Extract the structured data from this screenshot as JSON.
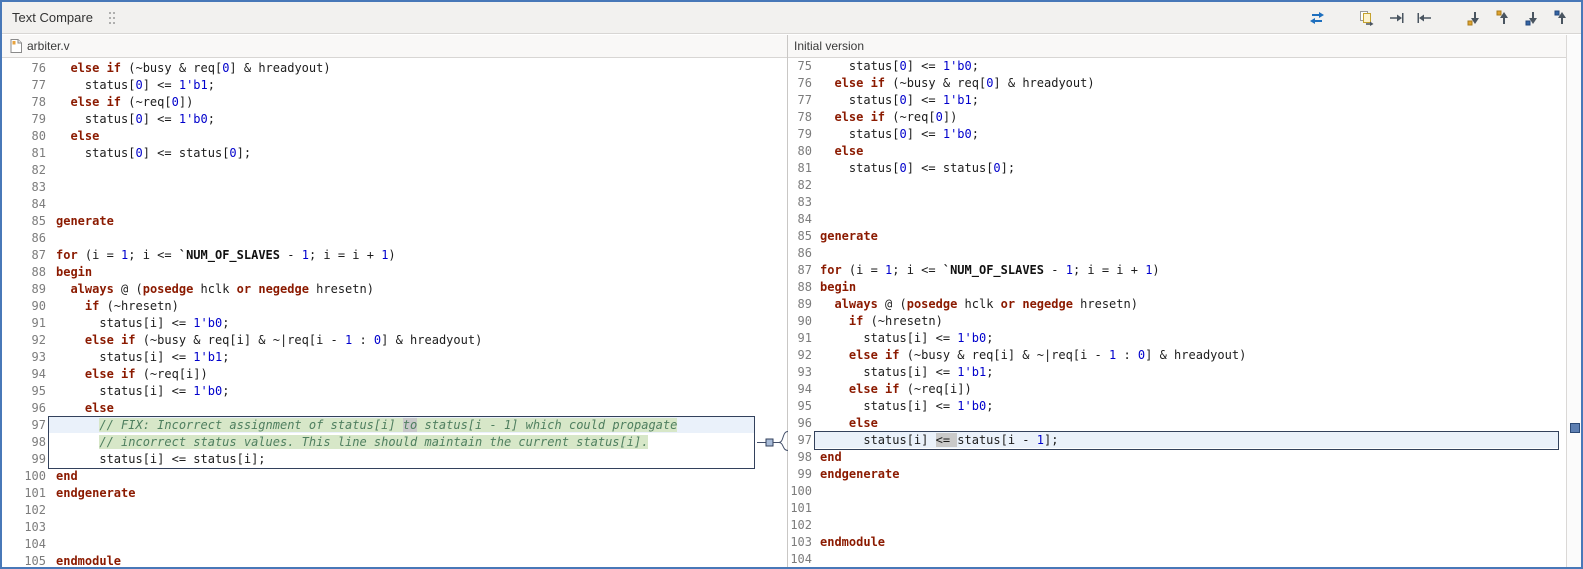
{
  "toolbar": {
    "title": "Text Compare",
    "icons": [
      "swap-left-right",
      "copy-all-left-to-right",
      "copy-current-left-to-right",
      "copy-current-right-to-left",
      "next-difference",
      "previous-difference",
      "next-change",
      "previous-change"
    ]
  },
  "colors": {
    "frame_border": "#4878b8",
    "keyword": "#8b1a00",
    "number": "#0000cc",
    "comment": "#4f7f5f",
    "macro": "#111111",
    "line_number": "#7c7c7c",
    "added_token_bg": "#d7e7c8",
    "changed_token_bg": "#c9c9c9",
    "diff_box_border": "#33415c"
  },
  "diff": {
    "left_from": 97,
    "left_to": 99,
    "right_from": 97,
    "right_to": 97
  },
  "left_pane": {
    "header": "arbiter.v",
    "lines": [
      {
        "n": 76,
        "s": [
          [
            "p",
            "  "
          ],
          [
            "k",
            "else if"
          ],
          [
            "p",
            " (~busy & req["
          ],
          [
            "n",
            "0"
          ],
          [
            "p",
            "] & hreadyout)"
          ]
        ]
      },
      {
        "n": 77,
        "s": [
          [
            "p",
            "    status["
          ],
          [
            "n",
            "0"
          ],
          [
            "p",
            "] <= "
          ],
          [
            "n",
            "1'b1"
          ],
          [
            "p",
            ";"
          ]
        ]
      },
      {
        "n": 78,
        "s": [
          [
            "p",
            "  "
          ],
          [
            "k",
            "else if"
          ],
          [
            "p",
            " (~req["
          ],
          [
            "n",
            "0"
          ],
          [
            "p",
            "])"
          ]
        ]
      },
      {
        "n": 79,
        "s": [
          [
            "p",
            "    status["
          ],
          [
            "n",
            "0"
          ],
          [
            "p",
            "] <= "
          ],
          [
            "n",
            "1'b0"
          ],
          [
            "p",
            ";"
          ]
        ]
      },
      {
        "n": 80,
        "s": [
          [
            "p",
            "  "
          ],
          [
            "k",
            "else"
          ]
        ]
      },
      {
        "n": 81,
        "s": [
          [
            "p",
            "    status["
          ],
          [
            "n",
            "0"
          ],
          [
            "p",
            "] <= status["
          ],
          [
            "n",
            "0"
          ],
          [
            "p",
            "];"
          ]
        ]
      },
      {
        "n": 82,
        "s": []
      },
      {
        "n": 83,
        "s": []
      },
      {
        "n": 84,
        "s": []
      },
      {
        "n": 85,
        "s": [
          [
            "k",
            "generate"
          ]
        ]
      },
      {
        "n": 86,
        "s": []
      },
      {
        "n": 87,
        "s": [
          [
            "k",
            "for"
          ],
          [
            "p",
            " (i = "
          ],
          [
            "n",
            "1"
          ],
          [
            "p",
            "; i <= "
          ],
          [
            "m",
            "`NUM_OF_SLAVES"
          ],
          [
            "p",
            " - "
          ],
          [
            "n",
            "1"
          ],
          [
            "p",
            "; i = i + "
          ],
          [
            "n",
            "1"
          ],
          [
            "p",
            ")"
          ]
        ]
      },
      {
        "n": 88,
        "s": [
          [
            "k",
            "begin"
          ]
        ]
      },
      {
        "n": 89,
        "s": [
          [
            "p",
            "  "
          ],
          [
            "k",
            "always"
          ],
          [
            "p",
            " @ ("
          ],
          [
            "k",
            "posedge"
          ],
          [
            "p",
            " hclk "
          ],
          [
            "k",
            "or"
          ],
          [
            "p",
            " "
          ],
          [
            "k",
            "negedge"
          ],
          [
            "p",
            " hresetn)"
          ]
        ]
      },
      {
        "n": 90,
        "s": [
          [
            "p",
            "    "
          ],
          [
            "k",
            "if"
          ],
          [
            "p",
            " (~hresetn)"
          ]
        ]
      },
      {
        "n": 91,
        "s": [
          [
            "p",
            "      status[i] <= "
          ],
          [
            "n",
            "1'b0"
          ],
          [
            "p",
            ";"
          ]
        ]
      },
      {
        "n": 92,
        "s": [
          [
            "p",
            "    "
          ],
          [
            "k",
            "else if"
          ],
          [
            "p",
            " (~busy & req[i] & ~|req[i - "
          ],
          [
            "n",
            "1"
          ],
          [
            "p",
            " : "
          ],
          [
            "n",
            "0"
          ],
          [
            "p",
            "] & hreadyout)"
          ]
        ]
      },
      {
        "n": 93,
        "s": [
          [
            "p",
            "      status[i] <= "
          ],
          [
            "n",
            "1'b1"
          ],
          [
            "p",
            ";"
          ]
        ]
      },
      {
        "n": 94,
        "s": [
          [
            "p",
            "    "
          ],
          [
            "k",
            "else if"
          ],
          [
            "p",
            " (~req[i])"
          ]
        ]
      },
      {
        "n": 95,
        "s": [
          [
            "p",
            "      status[i] <= "
          ],
          [
            "n",
            "1'b0"
          ],
          [
            "p",
            ";"
          ]
        ]
      },
      {
        "n": 96,
        "s": [
          [
            "p",
            "    "
          ],
          [
            "k",
            "else"
          ]
        ]
      },
      {
        "n": 97,
        "s": [
          [
            "p",
            "      "
          ],
          [
            "c",
            "// FIX: Incorrect assignment of status[i] ",
            "hg"
          ],
          [
            "c",
            "to",
            "hx"
          ],
          [
            "c",
            " status[i - 1] which could propagate",
            "hg"
          ]
        ]
      },
      {
        "n": 98,
        "s": [
          [
            "p",
            "      "
          ],
          [
            "c",
            "// incorrect status values. This line should maintain the current status[i].",
            "hg"
          ]
        ]
      },
      {
        "n": 99,
        "s": [
          [
            "p",
            "      status[i] <= status[i];"
          ]
        ]
      },
      {
        "n": 100,
        "s": [
          [
            "k",
            "end"
          ]
        ]
      },
      {
        "n": 101,
        "s": [
          [
            "k",
            "endgenerate"
          ]
        ]
      },
      {
        "n": 102,
        "s": []
      },
      {
        "n": 103,
        "s": []
      },
      {
        "n": 104,
        "s": []
      },
      {
        "n": 105,
        "s": [
          [
            "k",
            "endmodule"
          ]
        ]
      }
    ]
  },
  "right_pane": {
    "header": "Initial version",
    "lines": [
      {
        "n": 75,
        "s": [
          [
            "p",
            "    status["
          ],
          [
            "n",
            "0"
          ],
          [
            "p",
            "] <= "
          ],
          [
            "n",
            "1'b0"
          ],
          [
            "p",
            ";"
          ]
        ]
      },
      {
        "n": 76,
        "s": [
          [
            "p",
            "  "
          ],
          [
            "k",
            "else if"
          ],
          [
            "p",
            " (~busy & req["
          ],
          [
            "n",
            "0"
          ],
          [
            "p",
            "] & hreadyout)"
          ]
        ]
      },
      {
        "n": 77,
        "s": [
          [
            "p",
            "    status["
          ],
          [
            "n",
            "0"
          ],
          [
            "p",
            "] <= "
          ],
          [
            "n",
            "1'b1"
          ],
          [
            "p",
            ";"
          ]
        ]
      },
      {
        "n": 78,
        "s": [
          [
            "p",
            "  "
          ],
          [
            "k",
            "else if"
          ],
          [
            "p",
            " (~req["
          ],
          [
            "n",
            "0"
          ],
          [
            "p",
            "])"
          ]
        ]
      },
      {
        "n": 79,
        "s": [
          [
            "p",
            "    status["
          ],
          [
            "n",
            "0"
          ],
          [
            "p",
            "] <= "
          ],
          [
            "n",
            "1'b0"
          ],
          [
            "p",
            ";"
          ]
        ]
      },
      {
        "n": 80,
        "s": [
          [
            "p",
            "  "
          ],
          [
            "k",
            "else"
          ]
        ]
      },
      {
        "n": 81,
        "s": [
          [
            "p",
            "    status["
          ],
          [
            "n",
            "0"
          ],
          [
            "p",
            "] <= status["
          ],
          [
            "n",
            "0"
          ],
          [
            "p",
            "];"
          ]
        ]
      },
      {
        "n": 82,
        "s": []
      },
      {
        "n": 83,
        "s": []
      },
      {
        "n": 84,
        "s": []
      },
      {
        "n": 85,
        "s": [
          [
            "k",
            "generate"
          ]
        ]
      },
      {
        "n": 86,
        "s": []
      },
      {
        "n": 87,
        "s": [
          [
            "k",
            "for"
          ],
          [
            "p",
            " (i = "
          ],
          [
            "n",
            "1"
          ],
          [
            "p",
            "; i <= "
          ],
          [
            "m",
            "`NUM_OF_SLAVES"
          ],
          [
            "p",
            " - "
          ],
          [
            "n",
            "1"
          ],
          [
            "p",
            "; i = i + "
          ],
          [
            "n",
            "1"
          ],
          [
            "p",
            ")"
          ]
        ]
      },
      {
        "n": 88,
        "s": [
          [
            "k",
            "begin"
          ]
        ]
      },
      {
        "n": 89,
        "s": [
          [
            "p",
            "  "
          ],
          [
            "k",
            "always"
          ],
          [
            "p",
            " @ ("
          ],
          [
            "k",
            "posedge"
          ],
          [
            "p",
            " hclk "
          ],
          [
            "k",
            "or"
          ],
          [
            "p",
            " "
          ],
          [
            "k",
            "negedge"
          ],
          [
            "p",
            " hresetn)"
          ]
        ]
      },
      {
        "n": 90,
        "s": [
          [
            "p",
            "    "
          ],
          [
            "k",
            "if"
          ],
          [
            "p",
            " (~hresetn)"
          ]
        ]
      },
      {
        "n": 91,
        "s": [
          [
            "p",
            "      status[i] <= "
          ],
          [
            "n",
            "1'b0"
          ],
          [
            "p",
            ";"
          ]
        ]
      },
      {
        "n": 92,
        "s": [
          [
            "p",
            "    "
          ],
          [
            "k",
            "else if"
          ],
          [
            "p",
            " (~busy & req[i] & ~|req[i - "
          ],
          [
            "n",
            "1"
          ],
          [
            "p",
            " : "
          ],
          [
            "n",
            "0"
          ],
          [
            "p",
            "] & hreadyout)"
          ]
        ]
      },
      {
        "n": 93,
        "s": [
          [
            "p",
            "      status[i] <= "
          ],
          [
            "n",
            "1'b1"
          ],
          [
            "p",
            ";"
          ]
        ]
      },
      {
        "n": 94,
        "s": [
          [
            "p",
            "    "
          ],
          [
            "k",
            "else if"
          ],
          [
            "p",
            " (~req[i])"
          ]
        ]
      },
      {
        "n": 95,
        "s": [
          [
            "p",
            "      status[i] <= "
          ],
          [
            "n",
            "1'b0"
          ],
          [
            "p",
            ";"
          ]
        ]
      },
      {
        "n": 96,
        "s": [
          [
            "p",
            "    "
          ],
          [
            "k",
            "else"
          ]
        ]
      },
      {
        "n": 97,
        "s": [
          [
            "p",
            "      status[i] "
          ],
          [
            "p",
            "<= ",
            "hx"
          ],
          [
            "p",
            "status[i - "
          ],
          [
            "n",
            "1"
          ],
          [
            "p",
            "];"
          ]
        ]
      },
      {
        "n": 98,
        "s": [
          [
            "k",
            "end"
          ]
        ]
      },
      {
        "n": 99,
        "s": [
          [
            "k",
            "endgenerate"
          ]
        ]
      },
      {
        "n": 100,
        "s": []
      },
      {
        "n": 101,
        "s": []
      },
      {
        "n": 102,
        "s": []
      },
      {
        "n": 103,
        "s": [
          [
            "k",
            "endmodule"
          ]
        ]
      },
      {
        "n": 104,
        "s": []
      }
    ]
  }
}
